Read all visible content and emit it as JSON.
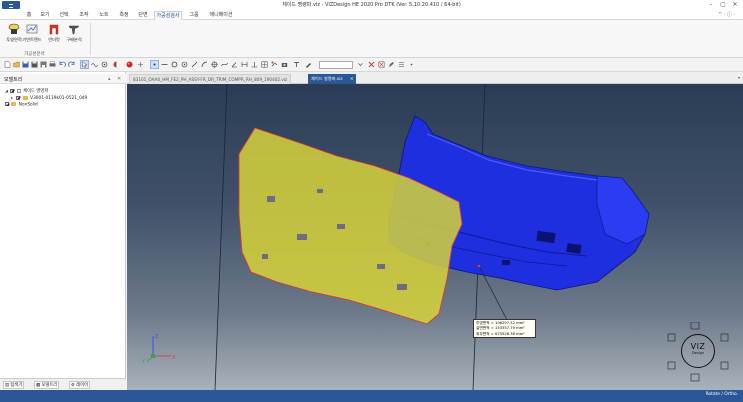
{
  "window": {
    "title": "체이드 명령파.viz - VIZDesign HE 2020 Pro DTK (Ver. 5.10.20.410 / 64-bit)",
    "min": "–",
    "max": "▢",
    "close": "✕"
  },
  "menu": {
    "tabs": [
      "홈",
      "보기",
      "선택",
      "조작",
      "노트",
      "측정",
      "단면",
      "가공성검사",
      "그룹",
      "애니메이션"
    ],
    "active": "가공성검사",
    "right": "^ · ⓘ ·"
  },
  "ribbon": {
    "buttons": [
      "투영면적",
      "기반트렌드",
      "언더컷",
      "구배분석"
    ],
    "group_label": "가공성분석"
  },
  "toolbar": {
    "zoom_value": ""
  },
  "tree": {
    "title": "모델트리",
    "pin": "▴",
    "close": "✕",
    "items": [
      {
        "label": "체이드 영명파",
        "level": 0,
        "checked": true,
        "folder": false,
        "arrow": "◢"
      },
      {
        "label": "V3001-0119k01-0521_049",
        "level": 1,
        "checked": true,
        "folder": true,
        "arrow": "▸"
      },
      {
        "label": "NonSolid",
        "level": 0,
        "checked": true,
        "folder": true,
        "arrow": ""
      }
    ],
    "tabs": [
      "탐색기",
      "모델트리",
      "레이어"
    ]
  },
  "doc_tabs": {
    "inactive": "83101_OAA0_HM_FE2_PH_ASSY-FR_DR_TRIM_COMPR_RH_809_190402.viz",
    "active": "체이드 영명파.viz",
    "active_close": "✕",
    "dropdown": "▾"
  },
  "measurement": {
    "lines": [
      "투영면적 = 196297.52 mm²",
      "실면면적 = 153357.79 mm²",
      "외부면적 = 675526.36 mm²"
    ]
  },
  "viz_cube": {
    "brand": "VIZ",
    "sub": "Design"
  },
  "axes": {
    "x": "X",
    "y": "Y",
    "z": "Z"
  },
  "status": {
    "text": "Rotate / Ortho."
  },
  "colors": {
    "accent": "#2b5797",
    "part_blue": "#1e2fe0",
    "projection_yellow": "#d6d23a",
    "projection_edge": "#d83a3a"
  }
}
